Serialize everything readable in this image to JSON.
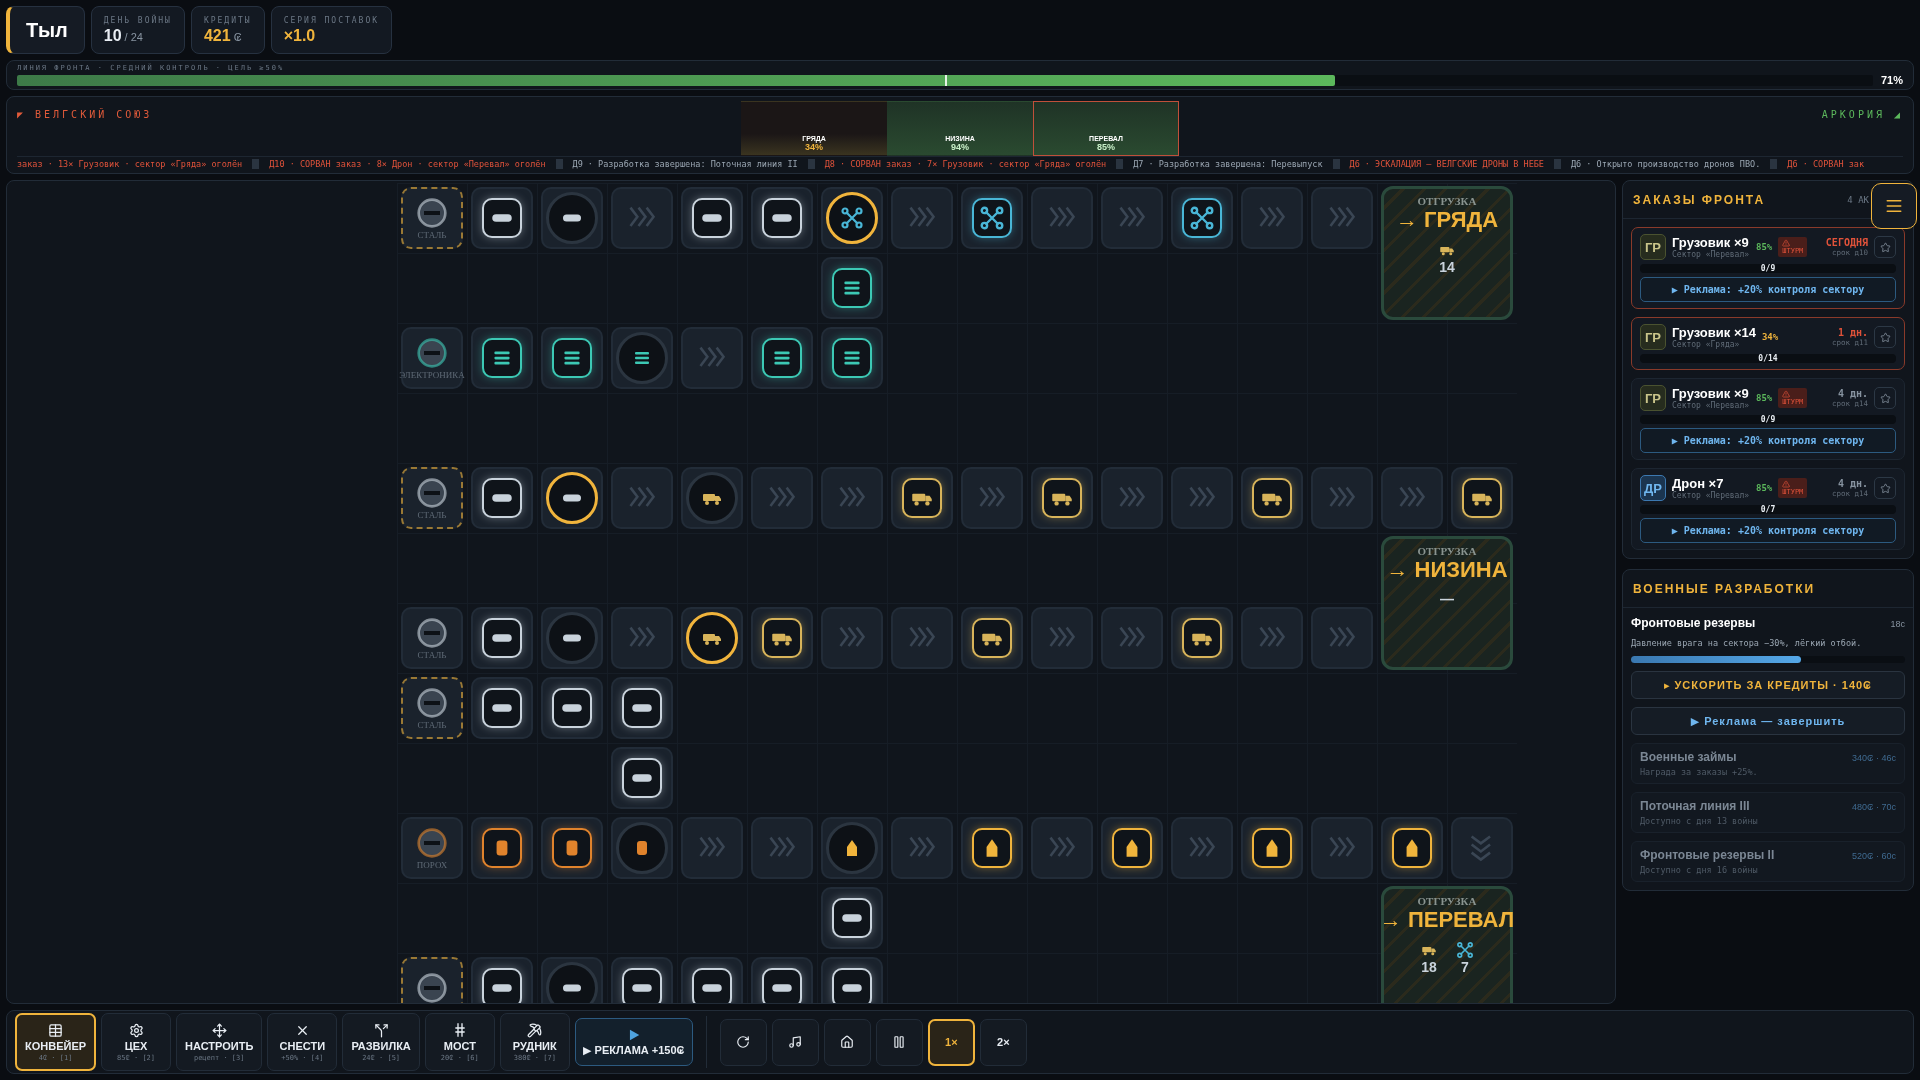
{
  "hud": {
    "title": "Тыл",
    "stats": [
      {
        "label": "ДЕНЬ ВОЙНЫ",
        "value": "10",
        "suffix": "/ 24"
      },
      {
        "label": "КРЕДИТЫ",
        "value": "421",
        "suffix": "₢"
      },
      {
        "label": "СЕРИЯ ПОСТАВОК",
        "value": "×1.0"
      }
    ]
  },
  "front": {
    "label": "ЛИНИЯ ФРОНТА · СРЕДНИЙ КОНТРОЛЬ · ЦЕЛЬ ≥50%",
    "level": 0.71,
    "goal": {
      "level": 0.5
    },
    "reading": "71%"
  },
  "map": {
    "left_faction": "◤ ВЕЛГСКИЙ СОЮЗ",
    "right_faction": "АРКОРИЯ ◢",
    "sectors": [
      {
        "name": "ГРЯДА",
        "reading": "34%",
        "kind": "contested",
        "under_attack": false
      },
      {
        "name": "НИЗИНА",
        "reading": "94%",
        "kind": "held",
        "under_attack": false
      },
      {
        "name": "ПЕРЕВАЛ",
        "reading": "85%",
        "kind": "held",
        "under_attack": true
      }
    ]
  },
  "ticker": [
    {
      "kind": "alert",
      "text": "заказ · 13× Грузовик · сектор «Гряда» оголён"
    },
    {
      "kind": "alert",
      "text": "Д10 · СОРВАН заказ · 8× Дрон · сектор «Перевал» оголён"
    },
    {
      "kind": "info",
      "text": "Д9 · Разработка завершена: Поточная линия II"
    },
    {
      "kind": "alert",
      "text": "Д8 · СОРВАН заказ · 7× Грузовик · сектор «Гряда» оголён"
    },
    {
      "kind": "info",
      "text": "Д7 · Разработка завершена: Перевыпуск"
    },
    {
      "kind": "alert",
      "text": "Д6 · ЭСКАЛАЦИЯ — ВЕЛГСКИЕ ДРОНЫ В НЕБЕ"
    },
    {
      "kind": "info",
      "text": "Д6 · Открыто производство дронов ПВО."
    },
    {
      "kind": "alert",
      "text": "Д6 · СОРВАН зак"
    }
  ],
  "grid": {
    "rows": [
      [
        {
          "kind": "source",
          "cargo": {
            "kind": "steel"
          },
          "label": "СТАЛЬ",
          "dashed": true
        },
        {
          "kind": "item",
          "cargo": {
            "kind": "steel"
          }
        },
        {
          "kind": "machine",
          "cargo": {
            "kind": "steel"
          },
          "active": false
        },
        {
          "kind": "belt"
        },
        {
          "kind": "item",
          "cargo": {
            "kind": "steel"
          }
        },
        {
          "kind": "item",
          "cargo": {
            "kind": "steel"
          }
        },
        {
          "kind": "machine",
          "cargo": {
            "kind": "drone"
          },
          "active": true
        },
        {
          "kind": "belt"
        },
        {
          "kind": "item",
          "cargo": {
            "kind": "drone"
          }
        },
        {
          "kind": "belt"
        },
        {
          "kind": "belt"
        },
        {
          "kind": "item",
          "cargo": {
            "kind": "drone"
          }
        },
        {
          "kind": "belt"
        },
        {
          "kind": "belt"
        },
        {
          "kind": "depot",
          "label": "ОТГРУЗКА",
          "target": "→ ГРЯДА",
          "counts": [
            {
              "kind": "truck",
              "value": "14"
            }
          ]
        }
      ],
      [
        {
          "kind": "empty"
        },
        {
          "kind": "empty"
        },
        {
          "kind": "empty"
        },
        {
          "kind": "empty"
        },
        {
          "kind": "empty"
        },
        {
          "kind": "empty"
        },
        {
          "kind": "item",
          "cargo": {
            "kind": "chip"
          }
        },
        {
          "kind": "empty"
        },
        {
          "kind": "empty"
        },
        {
          "kind": "empty"
        },
        {
          "kind": "empty"
        },
        {
          "kind": "empty"
        },
        {
          "kind": "empty"
        },
        {
          "kind": "empty"
        }
      ],
      [
        {
          "kind": "source",
          "cargo": {
            "kind": "chip"
          },
          "label": "ЭЛЕКТРОНИКА",
          "dashed": false
        },
        {
          "kind": "item",
          "cargo": {
            "kind": "chip"
          }
        },
        {
          "kind": "item",
          "cargo": {
            "kind": "chip"
          }
        },
        {
          "kind": "machine",
          "cargo": {
            "kind": "chip"
          },
          "active": false
        },
        {
          "kind": "belt"
        },
        {
          "kind": "item",
          "cargo": {
            "kind": "chip"
          }
        },
        {
          "kind": "item",
          "cargo": {
            "kind": "chip"
          }
        },
        {
          "kind": "empty"
        },
        {
          "kind": "empty"
        },
        {
          "kind": "empty"
        },
        {
          "kind": "empty"
        },
        {
          "kind": "empty"
        },
        {
          "kind": "empty"
        },
        {
          "kind": "empty"
        },
        {
          "kind": "empty"
        },
        {
          "kind": "empty"
        }
      ],
      [
        {
          "kind": "empty"
        },
        {
          "kind": "empty"
        },
        {
          "kind": "empty"
        },
        {
          "kind": "empty"
        },
        {
          "kind": "empty"
        },
        {
          "kind": "empty"
        },
        {
          "kind": "empty"
        },
        {
          "kind": "empty"
        },
        {
          "kind": "empty"
        },
        {
          "kind": "empty"
        },
        {
          "kind": "empty"
        },
        {
          "kind": "empty"
        },
        {
          "kind": "empty"
        },
        {
          "kind": "empty"
        },
        {
          "kind": "empty"
        },
        {
          "kind": "empty"
        }
      ],
      [
        {
          "kind": "source",
          "cargo": {
            "kind": "steel"
          },
          "label": "СТАЛЬ",
          "dashed": true
        },
        {
          "kind": "item",
          "cargo": {
            "kind": "steel"
          }
        },
        {
          "kind": "machine",
          "cargo": {
            "kind": "steel"
          },
          "active": true
        },
        {
          "kind": "belt"
        },
        {
          "kind": "machine",
          "cargo": {
            "kind": "truck"
          },
          "active": false
        },
        {
          "kind": "belt"
        },
        {
          "kind": "belt"
        },
        {
          "kind": "item",
          "cargo": {
            "kind": "truck"
          }
        },
        {
          "kind": "belt"
        },
        {
          "kind": "item",
          "cargo": {
            "kind": "truck"
          }
        },
        {
          "kind": "belt"
        },
        {
          "kind": "belt"
        },
        {
          "kind": "item",
          "cargo": {
            "kind": "truck"
          }
        },
        {
          "kind": "belt"
        },
        {
          "kind": "belt"
        },
        {
          "kind": "item",
          "cargo": {
            "kind": "truck"
          }
        }
      ],
      [
        {
          "kind": "empty"
        },
        {
          "kind": "empty"
        },
        {
          "kind": "empty"
        },
        {
          "kind": "empty"
        },
        {
          "kind": "empty"
        },
        {
          "kind": "empty"
        },
        {
          "kind": "empty"
        },
        {
          "kind": "empty"
        },
        {
          "kind": "empty"
        },
        {
          "kind": "empty"
        },
        {
          "kind": "empty"
        },
        {
          "kind": "empty"
        },
        {
          "kind": "empty"
        },
        {
          "kind": "empty"
        },
        {
          "kind": "depot",
          "label": "ОТГРУЗКА",
          "target": "→ НИЗИНА",
          "counts": [
            {
              "kind": "none",
              "value": "—"
            }
          ]
        }
      ],
      [
        {
          "kind": "source",
          "cargo": {
            "kind": "steel"
          },
          "label": "СТАЛЬ",
          "dashed": false
        },
        {
          "kind": "item",
          "cargo": {
            "kind": "steel"
          }
        },
        {
          "kind": "machine",
          "cargo": {
            "kind": "steel"
          },
          "active": false
        },
        {
          "kind": "belt"
        },
        {
          "kind": "machine",
          "cargo": {
            "kind": "truck"
          },
          "active": true
        },
        {
          "kind": "item",
          "cargo": {
            "kind": "truck"
          }
        },
        {
          "kind": "belt"
        },
        {
          "kind": "belt"
        },
        {
          "kind": "item",
          "cargo": {
            "kind": "truck"
          }
        },
        {
          "kind": "belt"
        },
        {
          "kind": "belt"
        },
        {
          "kind": "item",
          "cargo": {
            "kind": "truck"
          }
        },
        {
          "kind": "belt"
        },
        {
          "kind": "belt"
        }
      ],
      [
        {
          "kind": "source",
          "cargo": {
            "kind": "steel"
          },
          "label": "СТАЛЬ",
          "dashed": true
        },
        {
          "kind": "item",
          "cargo": {
            "kind": "steel"
          }
        },
        {
          "kind": "item",
          "cargo": {
            "kind": "steel"
          }
        },
        {
          "kind": "item",
          "cargo": {
            "kind": "steel"
          }
        },
        {
          "kind": "empty"
        },
        {
          "kind": "empty"
        },
        {
          "kind": "empty"
        },
        {
          "kind": "empty"
        },
        {
          "kind": "empty"
        },
        {
          "kind": "empty"
        },
        {
          "kind": "empty"
        },
        {
          "kind": "empty"
        },
        {
          "kind": "empty"
        },
        {
          "kind": "empty"
        },
        {
          "kind": "empty"
        },
        {
          "kind": "empty"
        }
      ],
      [
        {
          "kind": "empty"
        },
        {
          "kind": "empty"
        },
        {
          "kind": "empty"
        },
        {
          "kind": "item",
          "cargo": {
            "kind": "steel"
          }
        },
        {
          "kind": "empty"
        },
        {
          "kind": "empty"
        },
        {
          "kind": "empty"
        },
        {
          "kind": "empty"
        },
        {
          "kind": "empty"
        },
        {
          "kind": "empty"
        },
        {
          "kind": "empty"
        },
        {
          "kind": "empty"
        },
        {
          "kind": "empty"
        },
        {
          "kind": "empty"
        },
        {
          "kind": "empty"
        },
        {
          "kind": "empty"
        }
      ],
      [
        {
          "kind": "source",
          "cargo": {
            "kind": "powder"
          },
          "label": "ПОРОХ",
          "dashed": false
        },
        {
          "kind": "item",
          "cargo": {
            "kind": "powder"
          }
        },
        {
          "kind": "item",
          "cargo": {
            "kind": "powder"
          }
        },
        {
          "kind": "machine",
          "cargo": {
            "kind": "powder"
          },
          "active": false
        },
        {
          "kind": "belt"
        },
        {
          "kind": "belt"
        },
        {
          "kind": "machine",
          "cargo": {
            "kind": "shell"
          },
          "active": false
        },
        {
          "kind": "belt"
        },
        {
          "kind": "item",
          "cargo": {
            "kind": "shell"
          }
        },
        {
          "kind": "belt"
        },
        {
          "kind": "item",
          "cargo": {
            "kind": "shell"
          }
        },
        {
          "kind": "belt"
        },
        {
          "kind": "item",
          "cargo": {
            "kind": "shell"
          }
        },
        {
          "kind": "belt"
        },
        {
          "kind": "item",
          "cargo": {
            "kind": "shell"
          }
        },
        {
          "kind": "chute"
        }
      ],
      [
        {
          "kind": "empty"
        },
        {
          "kind": "empty"
        },
        {
          "kind": "empty"
        },
        {
          "kind": "empty"
        },
        {
          "kind": "empty"
        },
        {
          "kind": "empty"
        },
        {
          "kind": "item",
          "cargo": {
            "kind": "steel"
          }
        },
        {
          "kind": "empty"
        },
        {
          "kind": "empty"
        },
        {
          "kind": "empty"
        },
        {
          "kind": "empty"
        },
        {
          "kind": "empty"
        },
        {
          "kind": "empty"
        },
        {
          "kind": "empty"
        },
        {
          "kind": "depot",
          "label": "ОТГРУЗКА",
          "target": "→ ПЕРЕВАЛ",
          "counts": [
            {
              "kind": "truck",
              "value": "18"
            },
            {
              "kind": "drone",
              "value": "7"
            }
          ]
        }
      ],
      [
        {
          "kind": "source",
          "cargo": {
            "kind": "steel"
          },
          "dashed": true
        },
        {
          "kind": "item",
          "cargo": {
            "kind": "steel"
          }
        },
        {
          "kind": "machine",
          "cargo": {
            "kind": "steel"
          },
          "active": false
        },
        {
          "kind": "item",
          "cargo": {
            "kind": "steel"
          }
        },
        {
          "kind": "item",
          "cargo": {
            "kind": "steel"
          }
        },
        {
          "kind": "item",
          "cargo": {
            "kind": "steel"
          }
        },
        {
          "kind": "item",
          "cargo": {
            "kind": "steel"
          }
        },
        {
          "kind": "empty"
        },
        {
          "kind": "empty"
        },
        {
          "kind": "empty"
        },
        {
          "kind": "empty"
        },
        {
          "kind": "empty"
        },
        {
          "kind": "empty"
        },
        {
          "kind": "empty"
        }
      ]
    ]
  },
  "orders": {
    "title": "ЗАКАЗЫ ФРОНТА",
    "count": "4 АК",
    "items": [
      {
        "badge": "ГР",
        "kind": "truck",
        "title": "Грузовик ×9",
        "sector": "Сектор «Перевал»",
        "control": "85%",
        "control_low": false,
        "warning": "ШТУРМ",
        "due": "СЕГОДНЯ",
        "deadline": "срок д10",
        "urgent": true,
        "progress": "0/9",
        "level": 0,
        "ad": "▶ Реклама: +20% контроля сектору"
      },
      {
        "badge": "ГР",
        "kind": "truck",
        "title": "Грузовик ×14",
        "sector": "Сектор «Гряда»",
        "control": "34%",
        "control_low": true,
        "due": "1 дн.",
        "deadline": "срок д11",
        "urgent": true,
        "progress": "0/14",
        "level": 0
      },
      {
        "badge": "ГР",
        "kind": "truck",
        "title": "Грузовик ×9",
        "sector": "Сектор «Перевал»",
        "control": "85%",
        "control_low": false,
        "warning": "ШТУРМ",
        "due": "4 дн.",
        "deadline": "срок д14",
        "urgent": false,
        "progress": "0/9",
        "level": 0,
        "ad": "▶ Реклама: +20% контроля сектору"
      },
      {
        "badge": "ДР",
        "kind": "drone",
        "title": "Дрон ×7",
        "sector": "Сектор «Перевал»",
        "control": "85%",
        "control_low": false,
        "warning": "ШТУРМ",
        "due": "4 дн.",
        "deadline": "срок д14",
        "urgent": false,
        "progress": "0/7",
        "level": 0,
        "ad": "▶ Реклама: +20% контроля сектору"
      }
    ]
  },
  "research": {
    "title": "ВОЕННЫЕ РАЗРАБОТКИ",
    "current": {
      "name": "Фронтовые резервы",
      "time": "18с",
      "description": "Давление врага на сектора −30%, лёгкий отбой.",
      "level": 0.62,
      "speedup": "▸ УСКОРИТЬ ЗА КРЕДИТЫ · 140₢",
      "ad": "▶ Реклама — завершить"
    },
    "items": [
      {
        "name": "Военные займы",
        "cost": "340₢ · 46с",
        "note": "Награда за заказы +25%.",
        "locked": true
      },
      {
        "name": "Поточная линия III",
        "cost": "480₢ · 70с",
        "note": "Доступно с дня 13 войны",
        "locked": true
      },
      {
        "name": "Фронтовые резервы II",
        "cost": "520₢ · 60с",
        "note": "Доступно с дня 16 войны",
        "locked": true
      }
    ]
  },
  "toolbar": {
    "tools": [
      {
        "kind": "conveyor",
        "label": "КОНВЕЙЕР",
        "hint": "4₢ · [1]",
        "selected": true
      },
      {
        "kind": "workshop",
        "label": "ЦЕХ",
        "hint": "85₢ · [2]",
        "selected": false
      },
      {
        "kind": "configure",
        "label": "НАСТРОИТЬ",
        "hint": "рецепт · [3]",
        "selected": false
      },
      {
        "kind": "demolish",
        "label": "СНЕСТИ",
        "hint": "+50% · [4]",
        "selected": false
      },
      {
        "kind": "splitter",
        "label": "РАЗВИЛКА",
        "hint": "24₢ · [5]",
        "selected": false
      },
      {
        "kind": "bridge",
        "label": "МОСТ",
        "hint": "20₢ · [6]",
        "selected": false
      },
      {
        "kind": "mine",
        "label": "РУДНИК",
        "hint": "380₢ · [7]",
        "selected": false
      }
    ],
    "ad": "▶ РЕКЛАМА +150₢",
    "controls": [
      {
        "kind": "restart"
      },
      {
        "kind": "music"
      },
      {
        "kind": "home"
      },
      {
        "kind": "pause"
      },
      {
        "kind": "speed",
        "label": "1×",
        "selected": true
      },
      {
        "kind": "speed",
        "label": "2×",
        "selected": false
      }
    ]
  }
}
